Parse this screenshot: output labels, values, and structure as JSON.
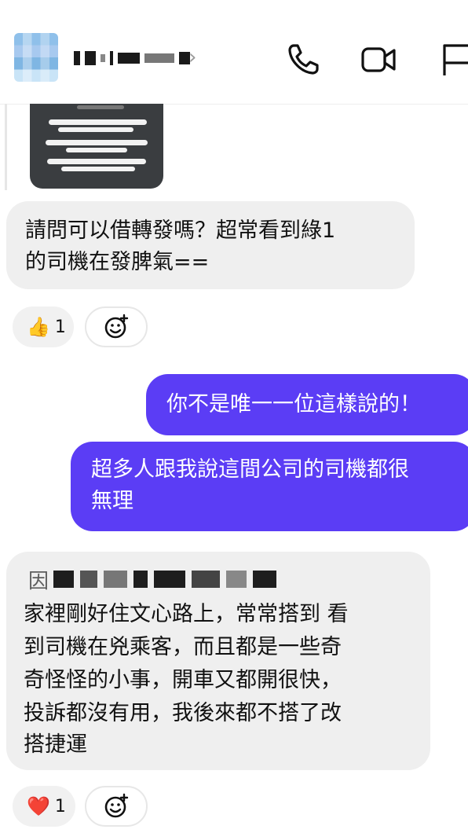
{
  "messages": {
    "incoming_1": {
      "line1": "請問可以借轉發嗎？超常看到綠1",
      "line2": "的司機在發脾氣==",
      "reaction_emoji": "👍",
      "reaction_count": "1"
    },
    "outgoing_1": "你不是唯一一位這樣說的！",
    "outgoing_2": {
      "line1": "超多人跟我說這間公司的司機都很",
      "line2": "無理"
    },
    "incoming_2": {
      "line0_visible": "因",
      "line1": "家裡剛好住文心路上，常常搭到 看",
      "line2": "到司機在兇乘客，而且都是一些奇",
      "line3": "奇怪怪的小事，開車又都開很快，",
      "line4": "投訴都沒有用，我後來都不搭了改",
      "line5": "搭捷運",
      "reaction_emoji": "❤️",
      "reaction_count": "1"
    }
  },
  "icons": {
    "call": "phone-icon",
    "video": "video-camera-icon",
    "flag": "flag-icon",
    "add_reaction": "add-reaction-icon"
  },
  "colors": {
    "outgoing_bubble": "#5b3df5",
    "incoming_bubble": "#efefef"
  }
}
